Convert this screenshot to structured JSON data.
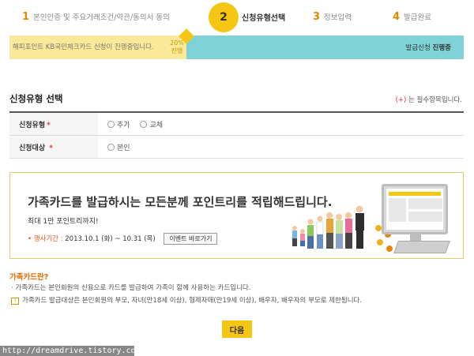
{
  "steps": [
    {
      "num": "1",
      "label": "본인인증 및 주요거래조건/약관/동의서 동의"
    },
    {
      "num": "2",
      "label": "신청유형선택"
    },
    {
      "num": "3",
      "label": "정보입력"
    },
    {
      "num": "4",
      "label": "발급완료"
    }
  ],
  "progress": {
    "message": "해피포인트 KB국민체크카드 신청이 진행중입니다.",
    "percent_line1": "20%",
    "percent_line2": "진행",
    "percent_value": 0.2,
    "state_prefix": "발급신청",
    "state_strong": "진행중"
  },
  "section": {
    "title": "신청유형 선택",
    "required_plus": "(+)",
    "required_text": "는 필수항목입니다."
  },
  "form": {
    "apply_type_label": "신청유형",
    "apply_type_options": [
      "추가",
      "교체"
    ],
    "target_label": "신청대상",
    "target_options": [
      "본인"
    ],
    "star": "*"
  },
  "banner": {
    "headline": "가족카드를 발급하시는 모든분께 포인트리를 적립해드립니다.",
    "sub": "최대 1만 포인트리까지!",
    "period_label": "• 행사기간 :",
    "period_value": "2013.10.1 (화) ~ 10.31 (목)",
    "event_button": "이벤트 바로가기"
  },
  "family_info": {
    "title": "가족카드란?",
    "line1": "· 가족카드는 본인회원의 신용으로 카드를 발급하여 가족이 함께 사용하는 카드입니다.",
    "warn_symbol": "!",
    "line2": "가족카드 발급대상은 본인회원의 부모, 자녀(만18세 이상), 형제자매(만19세 이상), 배우자, 배우자의 부모로 제한됩니다."
  },
  "next_button": "다음",
  "watermark": "http://dreamdrive.tistory.com",
  "colors": {
    "accent": "#f6c614",
    "progress_bg": "#7fd3d6",
    "progress_fill": "#fbe99a",
    "required": "#e0303a"
  }
}
